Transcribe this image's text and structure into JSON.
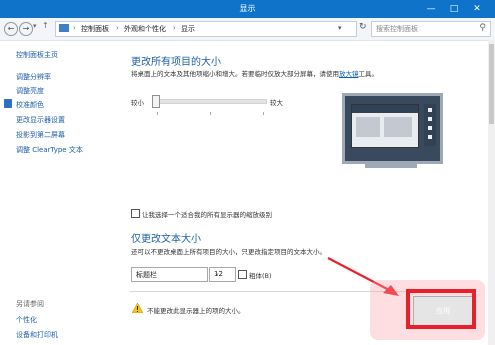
{
  "window": {
    "title": "显示",
    "min_icon": "minimize-icon",
    "max_icon": "maximize-icon",
    "close_icon": "close-icon"
  },
  "address": {
    "path": [
      "控制面板",
      "外观和个性化",
      "显示"
    ],
    "search_placeholder": "搜索控制面板"
  },
  "sidebar": {
    "home": "控制面板主页",
    "items": [
      "调整分辨率",
      "调整亮度",
      "校准颜色",
      "更改显示器设置",
      "投影到第二屏幕",
      "调整 ClearType 文本"
    ],
    "see_also_title": "另请参阅",
    "see_also": [
      "个性化",
      "设备和打印机"
    ]
  },
  "size_section": {
    "heading": "更改所有项目的大小",
    "desc_before": "将桌面上的文本及其他项缩小和增大。若要临时仅放大部分屏幕，请使用",
    "desc_link": "放大镜",
    "desc_after": "工具。",
    "slider_min": "较小",
    "slider_max": "较大",
    "slider_value": 0
  },
  "custom_scaling_checkbox": "让我选择一个适合我的所有显示器的缩放级别",
  "text_section": {
    "heading": "仅更改文本大小",
    "desc": "还可以不更改桌面上所有项目的大小，只更改指定项目的文本大小。",
    "item_select": "标题栏",
    "size_select": "12",
    "bold_label": "粗体(B)"
  },
  "warning": "不能更改此显示器上的项的大小。",
  "apply_button": "应用",
  "accent_colors": {
    "titlebar": "#0f73c9",
    "highlight": "#e8202a"
  }
}
